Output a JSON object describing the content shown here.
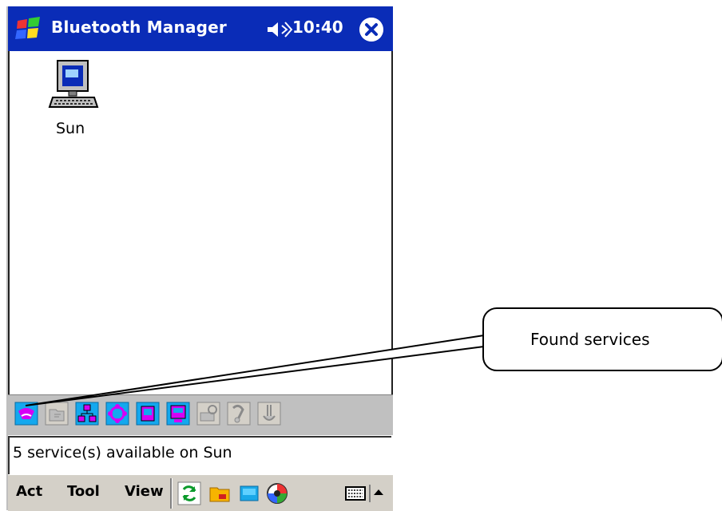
{
  "titlebar": {
    "title": "Bluetooth Manager",
    "time": "10:40"
  },
  "devices": [
    {
      "name": "Sun",
      "icon": "computer-icon"
    }
  ],
  "services": [
    {
      "icon": "found-service-icon",
      "state": "active"
    },
    {
      "icon": "file-transfer-icon",
      "state": "inactive"
    },
    {
      "icon": "network-icon",
      "state": "active"
    },
    {
      "icon": "dialup-icon",
      "state": "active"
    },
    {
      "icon": "serial-port-icon",
      "state": "active"
    },
    {
      "icon": "business-card-icon",
      "state": "active"
    },
    {
      "icon": "fax-icon",
      "state": "inactive"
    },
    {
      "icon": "headset-icon",
      "state": "inactive"
    },
    {
      "icon": "audio-icon",
      "state": "inactive"
    }
  ],
  "status": {
    "text": "5 service(s) available on Sun"
  },
  "menu": {
    "items": [
      "Act",
      "Tool",
      "View"
    ]
  },
  "callout": {
    "text": "Found services"
  },
  "colors": {
    "titlebar": "#0a2cb7",
    "service_active": "#14a8ee",
    "service_accent": "#d500f5",
    "service_inactive": "#bdbdbd"
  }
}
